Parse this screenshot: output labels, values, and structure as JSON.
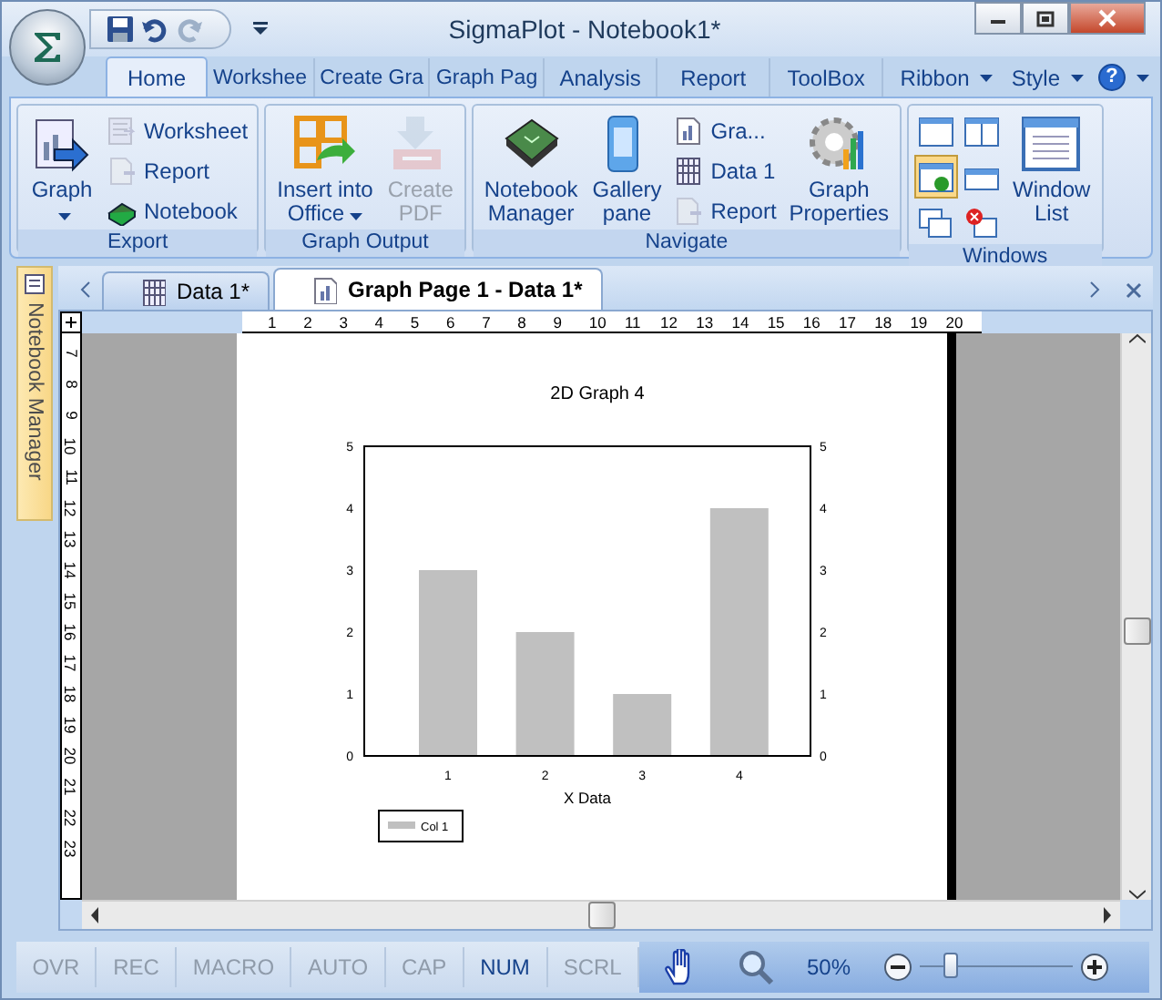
{
  "window": {
    "title": "SigmaPlot - Notebook1*"
  },
  "ribbon_tabs": [
    {
      "label": "Home",
      "selected": true
    },
    {
      "label": "Workshee",
      "selected": false
    },
    {
      "label": "Create Gra",
      "selected": false
    },
    {
      "label": "Graph Pag",
      "selected": false
    },
    {
      "label": "Analysis",
      "selected": false
    },
    {
      "label": "Report",
      "selected": false
    },
    {
      "label": "ToolBox",
      "selected": false
    }
  ],
  "ribbon_menus": [
    "Ribbon",
    "Style"
  ],
  "help_button": {
    "label": "?"
  },
  "ribbon_groups": [
    {
      "label": "Export",
      "items": [
        {
          "kind": "large",
          "lines": [
            "Graph"
          ],
          "dropdown": true,
          "disabled": false
        },
        {
          "kind": "small",
          "lines": [
            "Worksheet"
          ],
          "disabled": true
        },
        {
          "kind": "small",
          "lines": [
            "Report"
          ],
          "disabled": true
        },
        {
          "kind": "small",
          "lines": [
            "Notebook"
          ],
          "disabled": false
        }
      ]
    },
    {
      "label": "Graph Output",
      "items": [
        {
          "kind": "large",
          "lines": [
            "Insert into",
            "Office"
          ],
          "dropdown": true,
          "disabled": false
        },
        {
          "kind": "large",
          "lines": [
            "Create",
            "PDF"
          ],
          "dropdown": false,
          "disabled": true
        }
      ]
    },
    {
      "label": "Navigate",
      "items": [
        {
          "kind": "large",
          "lines": [
            "Notebook",
            "Manager"
          ],
          "dropdown": false,
          "disabled": false
        },
        {
          "kind": "large",
          "lines": [
            "Gallery",
            "pane"
          ],
          "dropdown": false,
          "disabled": false
        },
        {
          "kind": "small",
          "lines": [
            "Gra..."
          ],
          "disabled": false
        },
        {
          "kind": "small",
          "lines": [
            "Data 1"
          ],
          "disabled": false
        },
        {
          "kind": "small",
          "lines": [
            "Report"
          ],
          "disabled": true
        },
        {
          "kind": "large",
          "lines": [
            "Graph",
            "Properties"
          ],
          "dropdown": false,
          "disabled": false
        }
      ]
    },
    {
      "label": "Windows",
      "items": [
        {
          "kind": "icon",
          "selected": false
        },
        {
          "kind": "icon",
          "selected": false
        },
        {
          "kind": "icon",
          "selected": true
        },
        {
          "kind": "icon",
          "selected": false
        },
        {
          "kind": "icon",
          "selected": false
        },
        {
          "kind": "icon",
          "selected": false
        },
        {
          "kind": "large",
          "lines": [
            "Window",
            "List"
          ],
          "dropdown": false,
          "disabled": false
        }
      ]
    }
  ],
  "side_panel": {
    "label": "Notebook Manager"
  },
  "document_tabs": [
    {
      "label": "Data 1*",
      "selected": false
    },
    {
      "label": "Graph Page 1 - Data 1*",
      "selected": true
    }
  ],
  "ruler": {
    "horizontal": [
      "1",
      "2",
      "3",
      "4",
      "5",
      "6",
      "7",
      "8",
      "9",
      "10",
      "11",
      "12",
      "13",
      "14",
      "15",
      "16",
      "17",
      "18",
      "19",
      "20"
    ],
    "vertical": [
      "7",
      "8",
      "9",
      "10",
      "11",
      "12",
      "13",
      "14",
      "15",
      "16",
      "17",
      "18",
      "19",
      "20",
      "21",
      "22",
      "23"
    ]
  },
  "graph": {
    "chart_data": {
      "type": "bar",
      "title": "2D Graph 4",
      "xlabel": "X Data",
      "categories": [
        "1",
        "2",
        "3",
        "4"
      ],
      "series": [
        {
          "name": "Col 1",
          "color": "#c0c0c0",
          "values": [
            3,
            2,
            1,
            4
          ]
        }
      ],
      "ylim": [
        0,
        5
      ],
      "yticks": [
        {
          "value": 0,
          "label": "0"
        },
        {
          "value": 1,
          "label": "1"
        },
        {
          "value": 2,
          "label": "2"
        },
        {
          "value": 3,
          "label": "3"
        },
        {
          "value": 4,
          "label": "4"
        },
        {
          "value": 5,
          "label": "5"
        }
      ]
    }
  },
  "status_bar": {
    "indicators": [
      {
        "label": "OVR",
        "active": false
      },
      {
        "label": "REC",
        "active": false
      },
      {
        "label": "MACRO",
        "active": false
      },
      {
        "label": "AUTO",
        "active": false
      },
      {
        "label": "CAP",
        "active": false
      },
      {
        "label": "NUM",
        "active": true
      },
      {
        "label": "SCRL",
        "active": false
      }
    ],
    "zoom": {
      "reading": "50%",
      "level": 0.2
    }
  }
}
